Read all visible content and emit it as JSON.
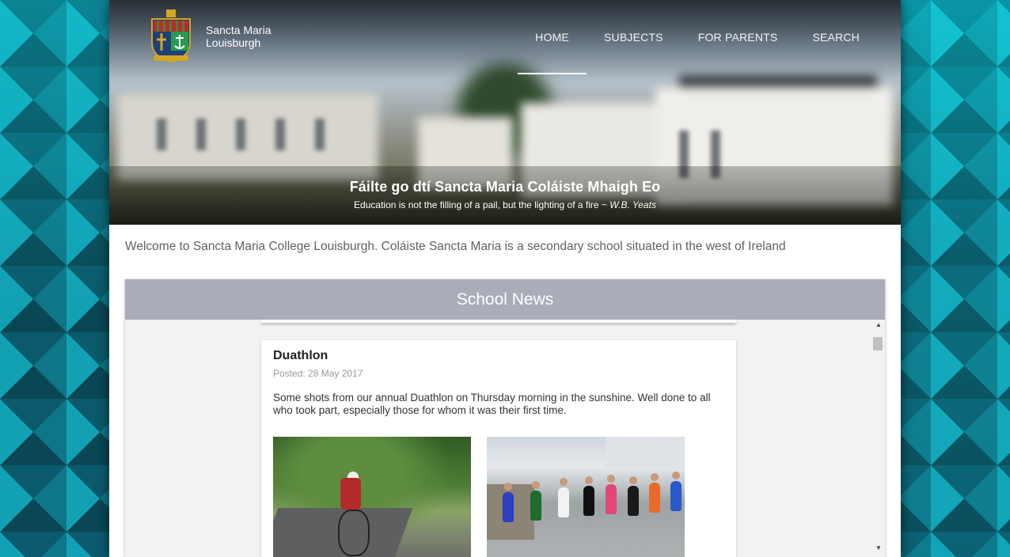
{
  "site": {
    "brand_line1": "Sancta Maria",
    "brand_line2": "Louisburgh",
    "logo_icon": "school-crest"
  },
  "nav": {
    "items": [
      {
        "label": "HOME",
        "active": true
      },
      {
        "label": "SUBJECTS",
        "active": false
      },
      {
        "label": "FOR PARENTS",
        "active": false
      },
      {
        "label": "SEARCH",
        "active": false
      }
    ]
  },
  "hero": {
    "title": "Fáilte go dtí Sancta Maria Coláiste Mhaigh Eo",
    "quote": "Education is not the filling of a pail, but the lighting of a fire ~ ",
    "quote_author": "W.B. Yeats"
  },
  "intro": {
    "text": "Welcome to Sancta Maria College Louisburgh. Coláiste Sancta Maria is a secondary school situated in the west of Ireland"
  },
  "news": {
    "header": "School News",
    "post": {
      "title": "Duathlon",
      "date": "Posted: 28 May 2017",
      "body": "Some shots from our annual Duathlon on Thursday morning in the sunshine. Well done to all who took part, especially those for whom it was their first time."
    }
  },
  "colors": {
    "news_header_bg": "#a9adb8",
    "page_bg_pattern": "#0e6f80"
  }
}
